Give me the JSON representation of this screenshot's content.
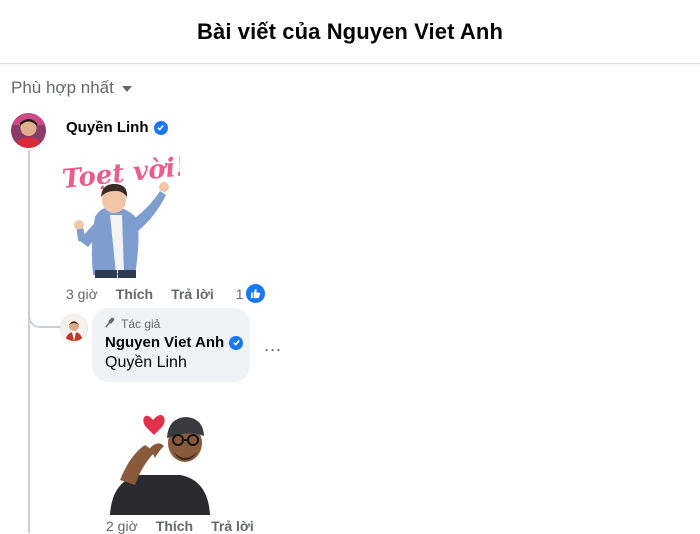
{
  "header": {
    "title": "Bài viết của Nguyen Viet Anh"
  },
  "sort": {
    "label": "Phù hợp nhất"
  },
  "comment1": {
    "author": "Quyền Linh",
    "sticker_text": "Toẹt vời!",
    "time": "3 giờ",
    "like_label": "Thích",
    "reply_label": "Trả lời",
    "like_count": "1"
  },
  "reply1": {
    "author_tag": "Tác giả",
    "author": "Nguyen Viet Anh",
    "text": "Quyền Linh",
    "more": "...",
    "time": "2 giờ",
    "like_label": "Thích",
    "reply_label": "Trả lời"
  },
  "colors": {
    "accent": "#1877f2",
    "muted": "#65676b",
    "bubble": "#f0f2f5"
  }
}
